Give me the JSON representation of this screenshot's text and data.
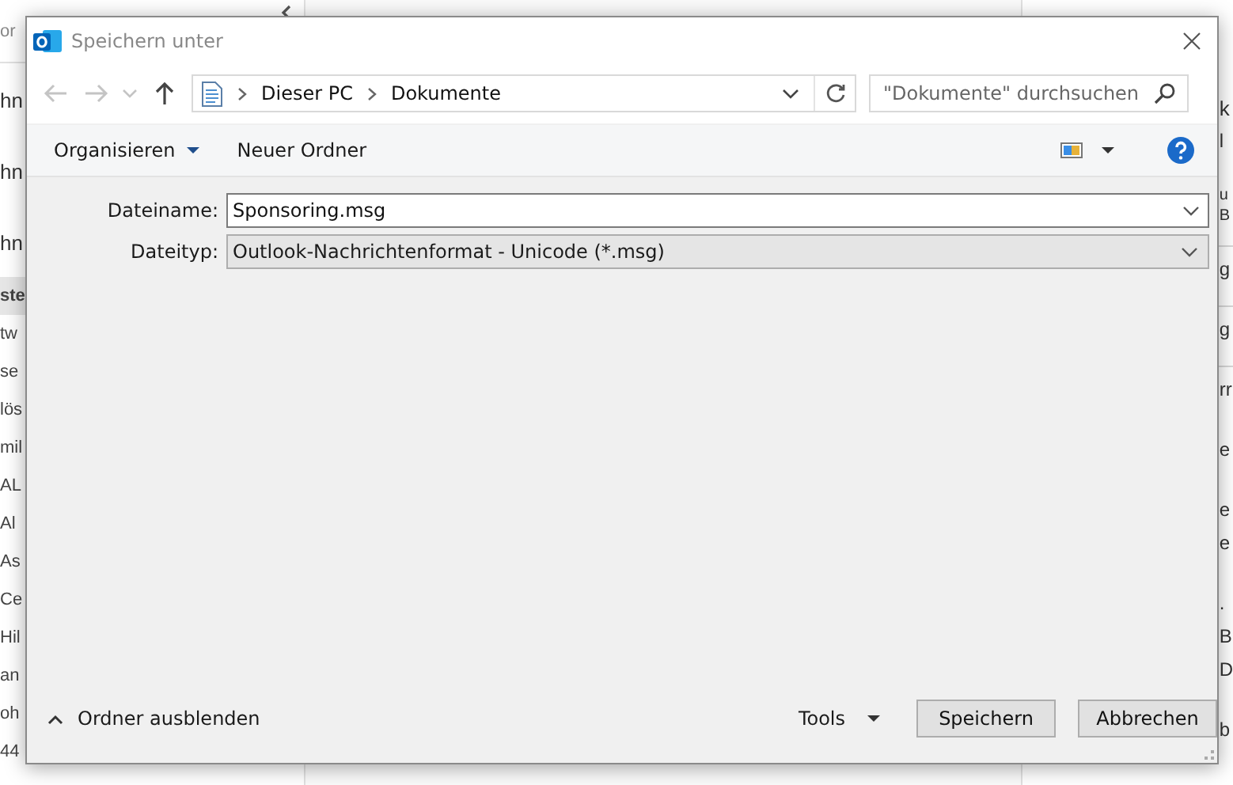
{
  "background": {
    "left_header": "or",
    "left_items": [
      {
        "text": "hn",
        "kind": "heading",
        "selected": false
      },
      {
        "text": "hn",
        "kind": "heading",
        "selected": false
      },
      {
        "text": "hn",
        "kind": "heading",
        "selected": false
      },
      {
        "text": "ste",
        "kind": "item",
        "selected": true
      },
      {
        "text": "tw",
        "kind": "item",
        "selected": false
      },
      {
        "text": "se",
        "kind": "item",
        "selected": false
      },
      {
        "text": "lös",
        "kind": "item",
        "selected": false
      },
      {
        "text": "mil",
        "kind": "item",
        "selected": false
      },
      {
        "text": "AL",
        "kind": "item",
        "selected": false
      },
      {
        "text": "Al",
        "kind": "item",
        "selected": false
      },
      {
        "text": "As",
        "kind": "item",
        "selected": false
      },
      {
        "text": "Ce",
        "kind": "item",
        "selected": false
      },
      {
        "text": "Hil",
        "kind": "item",
        "selected": false
      },
      {
        "text": "an",
        "kind": "item",
        "selected": false
      },
      {
        "text": "oh",
        "kind": "item",
        "selected": false
      },
      {
        "text": "44",
        "kind": "item",
        "selected": false
      }
    ],
    "right_blocks": [
      [
        {
          "text": "k",
          "kind": "heading"
        },
        {
          "text": "l",
          "kind": "text"
        }
      ],
      [
        {
          "text": "u",
          "kind": "small"
        },
        {
          "text": "B",
          "kind": "small"
        }
      ],
      [
        {
          "text": "g",
          "kind": "text"
        }
      ],
      [
        {
          "text": "g",
          "kind": "text"
        }
      ],
      [
        {
          "text": "rr",
          "kind": "text"
        }
      ],
      [
        {
          "text": "e",
          "kind": "text"
        }
      ],
      [
        {
          "text": "e",
          "kind": "text"
        },
        {
          "text": "e",
          "kind": "text"
        }
      ],
      [
        {
          "text": ".",
          "kind": "text"
        },
        {
          "text": "B",
          "kind": "text"
        },
        {
          "text": "D",
          "kind": "text"
        }
      ],
      [
        {
          "text": "b",
          "kind": "text"
        }
      ]
    ]
  },
  "dialog": {
    "title": "Speichern unter",
    "breadcrumb": [
      "Dieser PC",
      "Dokumente"
    ],
    "search": {
      "placeholder": "\"Dokumente\" durchsuchen"
    },
    "toolbar": {
      "organize": "Organisieren",
      "new_folder": "Neuer Ordner"
    },
    "fields": [
      {
        "label": "Dateiname:",
        "value": "Sponsoring.msg",
        "disabled": false
      },
      {
        "label": "Dateityp:",
        "value": "Outlook-Nachrichtenformat - Unicode (*.msg)",
        "disabled": true
      }
    ],
    "hide_folders": "Ordner ausblenden",
    "tools": "Tools",
    "buttons": [
      "Speichern",
      "Abbrechen"
    ]
  }
}
